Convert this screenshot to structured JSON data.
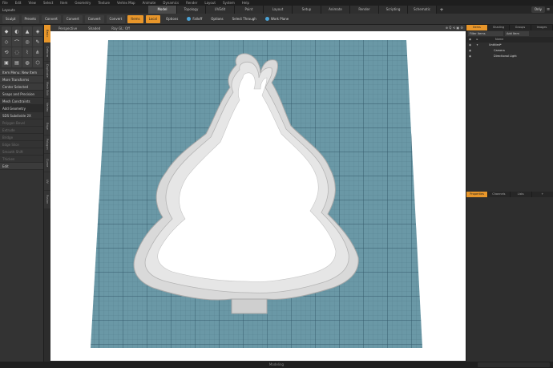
{
  "menubar": {
    "items": [
      "File",
      "Edit",
      "View",
      "Select",
      "Item",
      "Geometry",
      "Texture",
      "Vertex Map",
      "Animate",
      "Dynamics",
      "Render",
      "Layout",
      "System",
      "Help"
    ]
  },
  "layoutbar": {
    "layout_label": "Layouts",
    "tabs": [
      "Model",
      "Topology",
      "UVEdit",
      "Paint",
      "Layout",
      "Setup",
      "Animate",
      "Render",
      "Scripting",
      "Schematic Fusion"
    ],
    "active_tab": "Model",
    "add_label": "+",
    "only_label": "Only",
    "window_button": "≡"
  },
  "toolbar": {
    "sculpt": "Sculpt",
    "presets": "Presets",
    "convert_buttons": [
      "Convert",
      "Convert",
      "Convert",
      "Convert"
    ],
    "items_label": "Items",
    "local_label": "Local",
    "options1": "Options",
    "falloff": "Falloff",
    "options2": "Options",
    "select_through": "Select Through",
    "work_plane": "Work Plane"
  },
  "left_panel": {
    "tool_icons": [
      "◆",
      "◐",
      "▲",
      "◈",
      "◇",
      "⌒",
      "◎",
      "✎",
      "⟲",
      "◌",
      "⌇",
      "⋔",
      "▣",
      "▤",
      "◍",
      "⬡"
    ],
    "item_menu": "Item Menu: New Item",
    "more_transforms": "More Transforms",
    "center_selected": "Center Selected",
    "snaps": "Snaps and Precision",
    "mesh_constraints": "Mesh Constraints",
    "add_geometry": "Add Geometry",
    "sds_subdivide": "SDS Subdivide 2X",
    "dim_items": [
      "Polygon Bevel",
      "Extrude",
      "Bridge",
      "Edge Slice",
      "Smooth Shift",
      "Thicken"
    ],
    "edit": "Edit"
  },
  "vertical_tabs": [
    "Basic",
    "Deform",
    "Duplicate",
    "Mesh Edit",
    "Vertex",
    "Edge",
    "Polygon",
    "Curve",
    "UV",
    "Fusion"
  ],
  "viewport": {
    "header_items": [
      "Perspective",
      "Shaded",
      "Ray GL: Off"
    ],
    "header_icons": "⊕ Q ⟲ ▣ ⚙",
    "status_label": "Modeling"
  },
  "right_panel": {
    "tabs": [
      "Items",
      "Shading",
      "Groups",
      "Images"
    ],
    "active_tab": "Items",
    "filter_label": "Filter Items",
    "add_item": "Add Item",
    "name_col": "Name",
    "rows": [
      {
        "name": "Untitled*",
        "indent": 0
      },
      {
        "name": "Camera",
        "indent": 1
      },
      {
        "name": "Directional Light",
        "indent": 1
      }
    ],
    "bottom_tabs": [
      "Properties",
      "Channels",
      "Lists",
      "+"
    ]
  },
  "colors": {
    "grid_fill": "#6a98a6",
    "grid_line": "#4c7482",
    "cutter_fill": "#d9d9d9",
    "accent_orange": "#e8962a"
  }
}
